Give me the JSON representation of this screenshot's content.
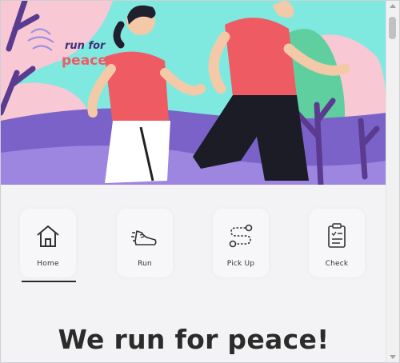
{
  "hero": {
    "logo_line1": "run for",
    "logo_line2": "peace"
  },
  "nav": {
    "items": [
      {
        "label": "Home",
        "icon": "home-icon"
      },
      {
        "label": "Run",
        "icon": "running-shoe-icon"
      },
      {
        "label": "Pick Up",
        "icon": "route-pickup-icon"
      },
      {
        "label": "Check",
        "icon": "clipboard-check-icon"
      }
    ]
  },
  "headline": "We run for peace!",
  "colors": {
    "sky": "#7fe9e0",
    "pink": "#f8c8d4",
    "purple": "#7b62c9",
    "shirt": "#ef5b63",
    "ground": "#f3f3f5"
  }
}
